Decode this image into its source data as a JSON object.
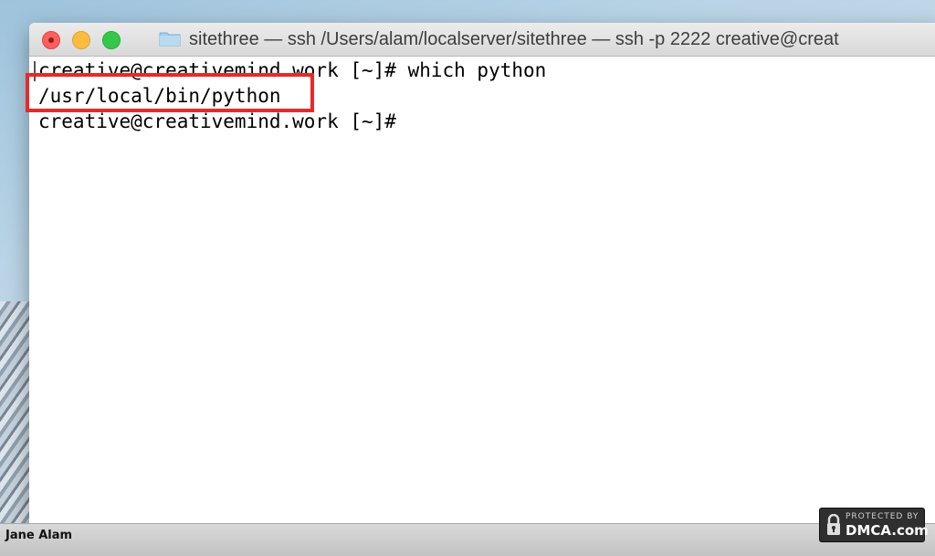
{
  "window": {
    "title": "sitethree — ssh  /Users/alam/localserver/sitethree — ssh -p 2222 creative@creat"
  },
  "terminal": {
    "lines": [
      "creative@creativemind.work [~]# which python",
      "/usr/local/bin/python",
      "creative@creativemind.work [~]#"
    ]
  },
  "annotation": {
    "highlight_color": "#e8292a"
  },
  "footer": {
    "author": "Jane Alam",
    "badge_top": "PROTECTED BY",
    "badge_main": "DMCA.com"
  }
}
